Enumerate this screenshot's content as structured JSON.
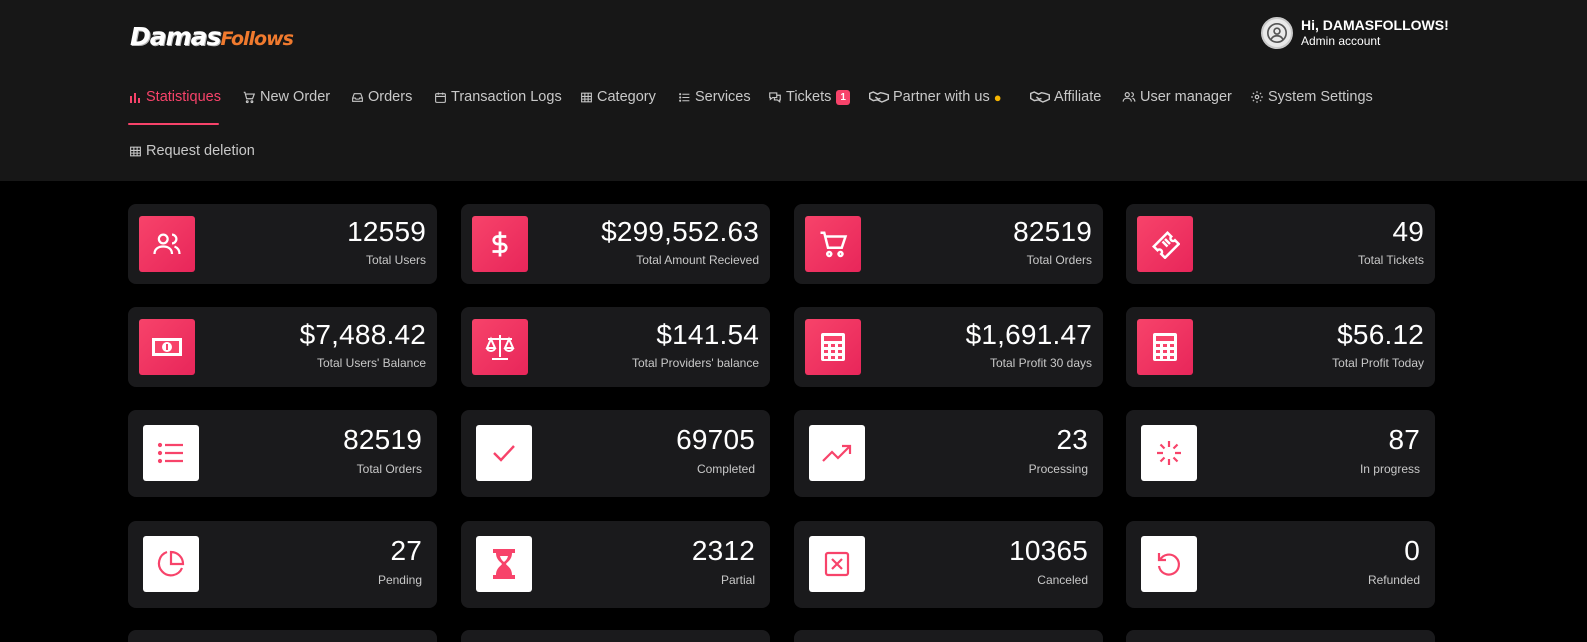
{
  "brand": {
    "part1": "Damas",
    "part2": "Follows"
  },
  "account": {
    "greeting": "Hi, DAMASFOLLOWS!",
    "role": "Admin account"
  },
  "nav": {
    "statistiques": "Statistiques",
    "new_order": "New Order",
    "orders": "Orders",
    "transaction_logs": "Transaction Logs",
    "category": "Category",
    "services": "Services",
    "tickets": "Tickets",
    "tickets_badge": "1",
    "partner": "Partner with us",
    "affiliate": "Affiliate",
    "user_manager": "User manager",
    "system_settings": "System Settings",
    "request_deletion": "Request deletion"
  },
  "stats": {
    "total_users": {
      "value": "12559",
      "label": "Total Users",
      "icon": "users-icon"
    },
    "total_amount": {
      "value": "$299,552.63",
      "label": "Total Amount Recieved",
      "icon": "dollar-icon"
    },
    "total_orders_top": {
      "value": "82519",
      "label": "Total Orders",
      "icon": "cart-icon"
    },
    "total_tickets": {
      "value": "49",
      "label": "Total Tickets",
      "icon": "ticket-icon"
    },
    "users_balance": {
      "value": "$7,488.42",
      "label": "Total Users' Balance",
      "icon": "money-icon"
    },
    "providers_balance": {
      "value": "$141.54",
      "label": "Total Providers' balance",
      "icon": "scale-icon"
    },
    "profit_30": {
      "value": "$1,691.47",
      "label": "Total Profit 30 days",
      "icon": "calculator-icon"
    },
    "profit_today": {
      "value": "$56.12",
      "label": "Total Profit Today",
      "icon": "calculator-icon"
    },
    "orders_total": {
      "value": "82519",
      "label": "Total Orders",
      "icon": "list-icon"
    },
    "completed": {
      "value": "69705",
      "label": "Completed",
      "icon": "check-icon"
    },
    "processing": {
      "value": "23",
      "label": "Processing",
      "icon": "trend-icon"
    },
    "in_progress": {
      "value": "87",
      "label": "In progress",
      "icon": "spinner-icon"
    },
    "pending": {
      "value": "27",
      "label": "Pending",
      "icon": "pie-icon"
    },
    "partial": {
      "value": "2312",
      "label": "Partial",
      "icon": "hourglass-icon"
    },
    "canceled": {
      "value": "10365",
      "label": "Canceled",
      "icon": "cancel-icon"
    },
    "refunded": {
      "value": "0",
      "label": "Refunded",
      "icon": "refund-icon"
    }
  },
  "colors": {
    "accent": "#f7436a",
    "header_bg": "#171717",
    "page_bg": "#000000",
    "card_bg": "#1a1a1c",
    "coin": "#f5b400"
  }
}
